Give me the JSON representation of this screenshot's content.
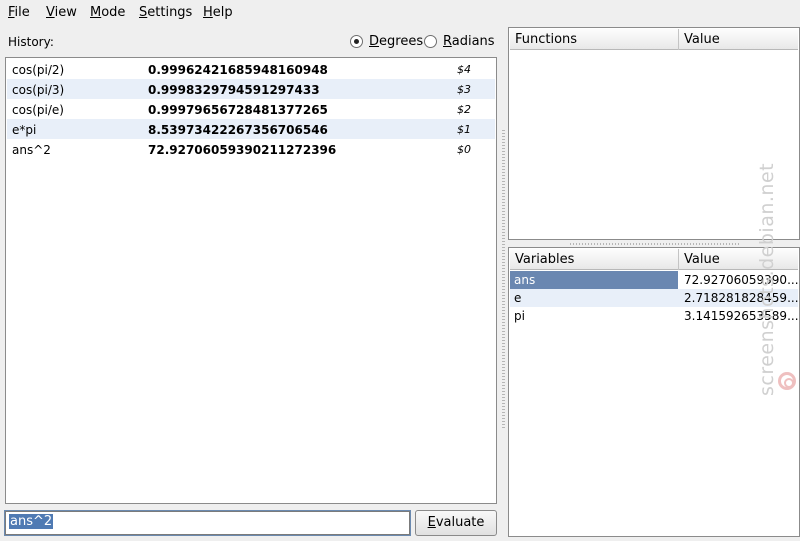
{
  "menu": [
    {
      "pre": "",
      "accel": "F",
      "post": "ile"
    },
    {
      "pre": "",
      "accel": "V",
      "post": "iew"
    },
    {
      "pre": "",
      "accel": "M",
      "post": "ode"
    },
    {
      "pre": "",
      "accel": "S",
      "post": "ettings"
    },
    {
      "pre": "",
      "accel": "H",
      "post": "elp"
    }
  ],
  "history": {
    "label": "History:",
    "angle_mode": {
      "degrees": {
        "accel": "D",
        "rest": "egrees",
        "selected": true
      },
      "radians": {
        "accel": "R",
        "rest": "adians",
        "selected": false
      }
    },
    "rows": [
      {
        "expr": "cos(pi/2)",
        "result": "0.99962421685948160948",
        "id": "$4"
      },
      {
        "expr": "cos(pi/3)",
        "result": "0.9998329794591297433",
        "id": "$3"
      },
      {
        "expr": "cos(pi/e)",
        "result": "0.99979656728481377265",
        "id": "$2"
      },
      {
        "expr": "e*pi",
        "result": "8.53973422267356706546",
        "id": "$1"
      },
      {
        "expr": "ans^2",
        "result": "72.92706059390211272396",
        "id": "$0"
      }
    ]
  },
  "input": {
    "value": "ans^2"
  },
  "evaluate": {
    "accel": "E",
    "rest": "valuate"
  },
  "functions": {
    "headers": [
      "Functions",
      "Value"
    ],
    "rows": []
  },
  "variables": {
    "headers": [
      "Variables",
      "Value"
    ],
    "rows": [
      {
        "name": "ans",
        "value": "72.92706059390...",
        "selected": true
      },
      {
        "name": "e",
        "value": "2.718281828459...",
        "selected": false
      },
      {
        "name": "pi",
        "value": "3.141592653589...",
        "selected": false
      }
    ]
  },
  "watermark": "screenshots.debian.net"
}
